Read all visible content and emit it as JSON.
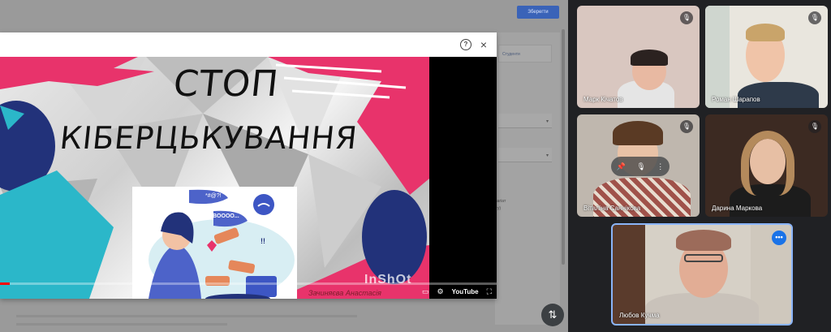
{
  "classroom": {
    "save_label": "Зберегти",
    "chip_label": "Студенти",
    "note_line1": "на плагіат",
    "note_line2": "нтенту)"
  },
  "dialog": {
    "help_icon": "?",
    "close_icon": "×"
  },
  "video": {
    "title_line1": "СТОП",
    "title_line2": "КІБЕРЦЬКУВАННЯ",
    "bubble_text": "BOOOO...",
    "symbols": "*#@?!",
    "exclaim": "!!",
    "watermark": "InShOt",
    "credit": "Зачиняєва Анастасія",
    "youtube_label": "YouTube",
    "progress_fraction": 0.02
  },
  "participants": [
    {
      "name": "Марк Кічатов",
      "muted": true
    },
    {
      "name": "Роман Шарапов",
      "muted": true
    },
    {
      "name": "Віталіна Саннікова",
      "muted": true
    },
    {
      "name": "Дарина Маркова",
      "muted": true
    },
    {
      "name": "Любов Кучма",
      "speaking": true
    }
  ],
  "colors": {
    "meet_bg": "#202124",
    "save_button": "#3a63b8",
    "accent_pink": "#e8336b",
    "accent_blue": "#22327a",
    "accent_cyan": "#2bb7c9",
    "speaking_blue": "#1a73e8"
  }
}
